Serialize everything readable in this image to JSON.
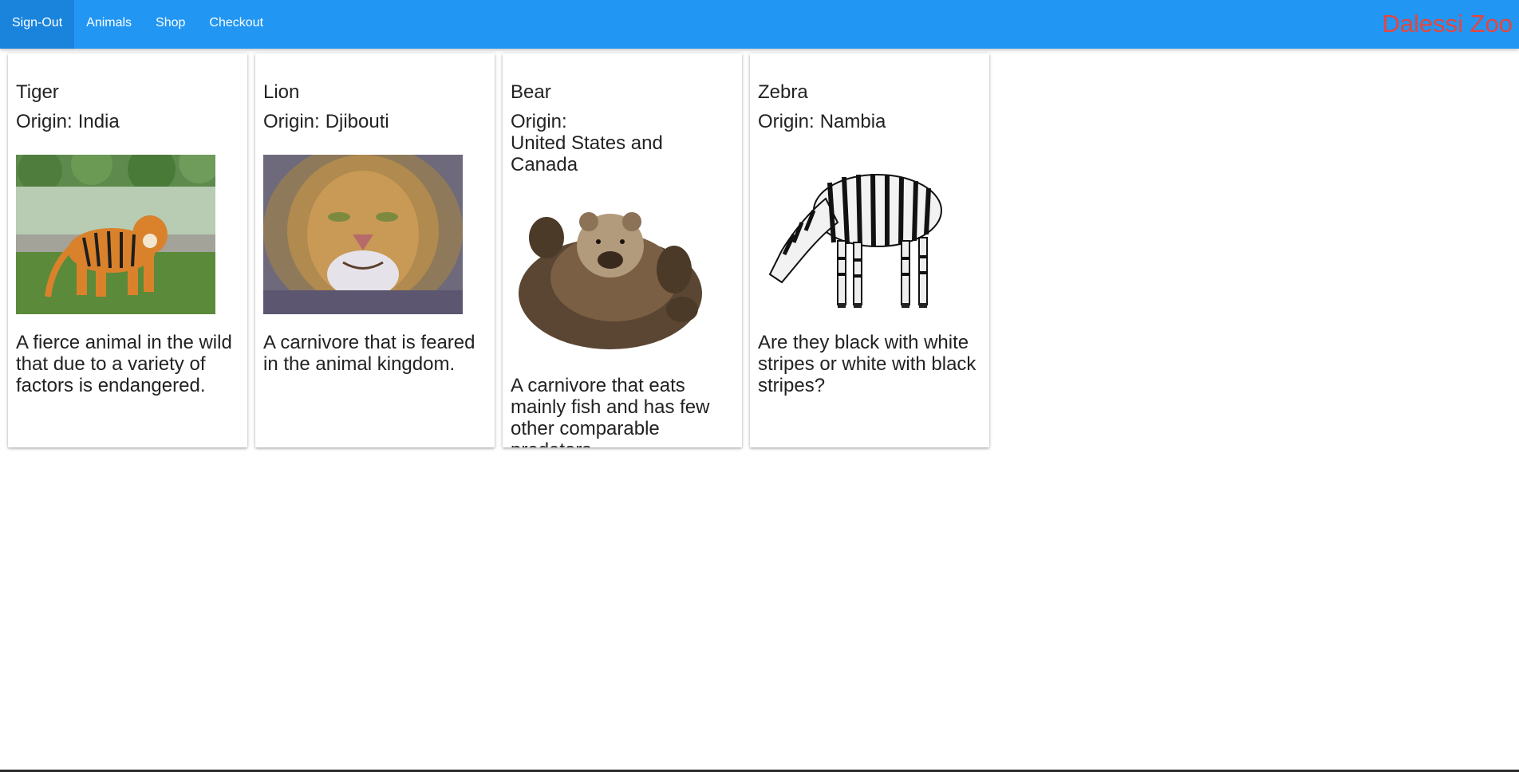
{
  "nav": {
    "items": [
      {
        "label": "Sign-Out"
      },
      {
        "label": "Animals"
      },
      {
        "label": "Shop"
      },
      {
        "label": "Checkout"
      }
    ],
    "brand": "Dalessi Zoo"
  },
  "origin_label": "Origin:",
  "animals": [
    {
      "name": "Tiger",
      "origin": "India",
      "description": "A fierce animal in the wild that due to a variety of factors is endangered."
    },
    {
      "name": "Lion",
      "origin": "Djibouti",
      "description": "A carnivore that is feared in the animal kingdom."
    },
    {
      "name": "Bear",
      "origin": "United States and Canada",
      "description": "A carnivore that eats mainly fish and has few other comparable predators."
    },
    {
      "name": "Zebra",
      "origin": "Nambia",
      "description": "Are they black with white stripes or white with black stripes?"
    }
  ],
  "colors": {
    "navbar": "#2196f3",
    "brand": "#e8453c",
    "text": "#222222"
  }
}
